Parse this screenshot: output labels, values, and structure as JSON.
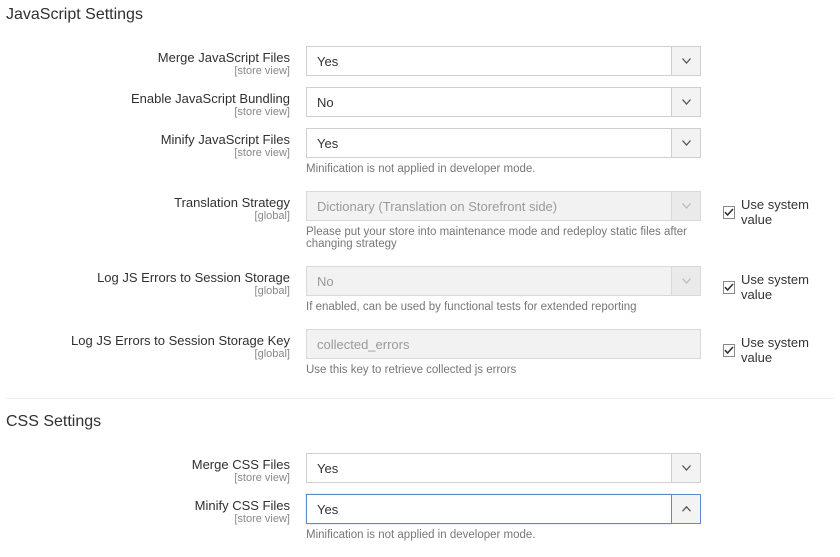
{
  "js_section": {
    "title": "JavaScript Settings",
    "fields": {
      "merge_js": {
        "label": "Merge JavaScript Files",
        "scope": "[store view]",
        "value": "Yes",
        "disabled": false,
        "focused": false,
        "note": "",
        "use_system_visible": false,
        "use_system_checked": false
      },
      "enable_bundling": {
        "label": "Enable JavaScript Bundling",
        "scope": "[store view]",
        "value": "No",
        "disabled": false,
        "focused": false,
        "note": "",
        "use_system_visible": false,
        "use_system_checked": false
      },
      "minify_js": {
        "label": "Minify JavaScript Files",
        "scope": "[store view]",
        "value": "Yes",
        "disabled": false,
        "focused": false,
        "note": "Minification is not applied in developer mode.",
        "use_system_visible": false,
        "use_system_checked": false
      },
      "translation_strategy": {
        "label": "Translation Strategy",
        "scope": "[global]",
        "value": "Dictionary (Translation on Storefront side)",
        "disabled": true,
        "focused": false,
        "note": "Please put your store into maintenance mode and redeploy static files after changing strategy",
        "use_system_visible": true,
        "use_system_checked": true
      },
      "log_js_errors": {
        "label": "Log JS Errors to Session Storage",
        "scope": "[global]",
        "value": "No",
        "disabled": true,
        "focused": false,
        "note": "If enabled, can be used by functional tests for extended reporting",
        "use_system_visible": true,
        "use_system_checked": true
      },
      "log_js_errors_key": {
        "label": "Log JS Errors to Session Storage Key",
        "scope": "[global]",
        "value": "collected_errors",
        "disabled": true,
        "focused": false,
        "note": "Use this key to retrieve collected js errors",
        "use_system_visible": true,
        "use_system_checked": true
      }
    }
  },
  "css_section": {
    "title": "CSS Settings",
    "fields": {
      "merge_css": {
        "label": "Merge CSS Files",
        "scope": "[store view]",
        "value": "Yes",
        "disabled": false,
        "focused": false,
        "note": "",
        "use_system_visible": false,
        "use_system_checked": false
      },
      "minify_css": {
        "label": "Minify CSS Files",
        "scope": "[store view]",
        "value": "Yes",
        "disabled": false,
        "focused": true,
        "note": "Minification is not applied in developer mode.",
        "use_system_visible": false,
        "use_system_checked": false
      }
    }
  },
  "use_system_label": "Use system value",
  "icons": {
    "chevron_down": "chevron-down-icon",
    "chevron_up": "chevron-up-icon",
    "checkmark": "checkmark-icon"
  }
}
